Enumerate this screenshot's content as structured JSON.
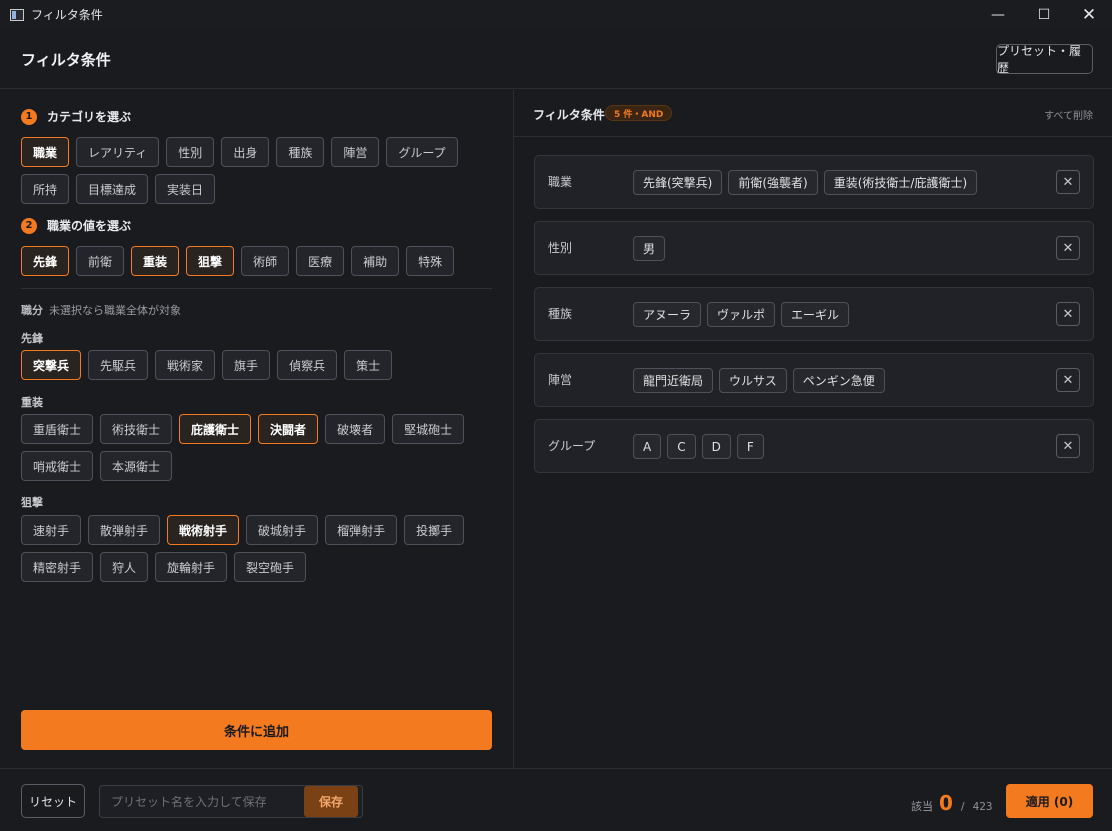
{
  "window": {
    "title": "フィルタ条件"
  },
  "header": {
    "title": "フィルタ条件",
    "preset_history_label": "プリセット・履歴"
  },
  "step1": {
    "num": "1",
    "label": "カテゴリを選ぶ",
    "categories": [
      {
        "label": "職業",
        "selected": true
      },
      {
        "label": "レアリティ",
        "selected": false
      },
      {
        "label": "性別",
        "selected": false
      },
      {
        "label": "出身",
        "selected": false
      },
      {
        "label": "種族",
        "selected": false
      },
      {
        "label": "陣営",
        "selected": false
      },
      {
        "label": "グループ",
        "selected": false
      },
      {
        "label": "所持",
        "selected": false
      },
      {
        "label": "目標達成",
        "selected": false
      },
      {
        "label": "実装日",
        "selected": false
      }
    ]
  },
  "step2": {
    "num": "2",
    "label": "職業の値を選ぶ",
    "values": [
      {
        "label": "先鋒",
        "selected": true
      },
      {
        "label": "前衛",
        "selected": false
      },
      {
        "label": "重装",
        "selected": true
      },
      {
        "label": "狙撃",
        "selected": true
      },
      {
        "label": "術師",
        "selected": false
      },
      {
        "label": "医療",
        "selected": false
      },
      {
        "label": "補助",
        "selected": false
      },
      {
        "label": "特殊",
        "selected": false
      }
    ]
  },
  "subclass": {
    "title": "職分",
    "hint": "未選択なら職業全体が対象",
    "groups": [
      {
        "name": "先鋒",
        "items": [
          {
            "label": "突撃兵",
            "selected": true
          },
          {
            "label": "先駆兵",
            "selected": false
          },
          {
            "label": "戦術家",
            "selected": false
          },
          {
            "label": "旗手",
            "selected": false
          },
          {
            "label": "偵察兵",
            "selected": false
          },
          {
            "label": "策士",
            "selected": false
          }
        ]
      },
      {
        "name": "重装",
        "items": [
          {
            "label": "重盾衛士",
            "selected": false
          },
          {
            "label": "術技衛士",
            "selected": false
          },
          {
            "label": "庇護衛士",
            "selected": true
          },
          {
            "label": "決闘者",
            "selected": true
          },
          {
            "label": "破壊者",
            "selected": false
          },
          {
            "label": "堅城砲士",
            "selected": false
          },
          {
            "label": "哨戒衛士",
            "selected": false
          },
          {
            "label": "本源衛士",
            "selected": false
          }
        ]
      },
      {
        "name": "狙撃",
        "items": [
          {
            "label": "速射手",
            "selected": false
          },
          {
            "label": "散弾射手",
            "selected": false
          },
          {
            "label": "戦術射手",
            "selected": true
          },
          {
            "label": "破城射手",
            "selected": false
          },
          {
            "label": "榴弾射手",
            "selected": false
          },
          {
            "label": "投擲手",
            "selected": false
          },
          {
            "label": "精密射手",
            "selected": false
          },
          {
            "label": "狩人",
            "selected": false
          },
          {
            "label": "旋輪射手",
            "selected": false
          },
          {
            "label": "裂空砲手",
            "selected": false
          }
        ]
      }
    ]
  },
  "add_button_label": "条件に追加",
  "conditions": {
    "title": "フィルタ条件",
    "badge": "5 件・AND",
    "clear_all": "すべて削除",
    "items": [
      {
        "name": "職業",
        "values": [
          "先鋒(突撃兵)",
          "前衛(強襲者)",
          "重装(術技衛士/庇護衛士)"
        ]
      },
      {
        "name": "性別",
        "values": [
          "男"
        ]
      },
      {
        "name": "種族",
        "values": [
          "アヌーラ",
          "ヴァルポ",
          "エーギル"
        ]
      },
      {
        "name": "陣営",
        "values": [
          "龍門近衛局",
          "ウルサス",
          "ペンギン急便"
        ]
      },
      {
        "name": "グループ",
        "values": [
          "A",
          "C",
          "D",
          "F"
        ]
      }
    ]
  },
  "footer": {
    "reset_label": "リセット",
    "preset_placeholder": "プリセット名を入力して保存",
    "save_label": "保存",
    "count_label": "該当",
    "count_current": "0",
    "count_sep": "/",
    "count_total": "423",
    "apply_label": "適用 (0)"
  }
}
